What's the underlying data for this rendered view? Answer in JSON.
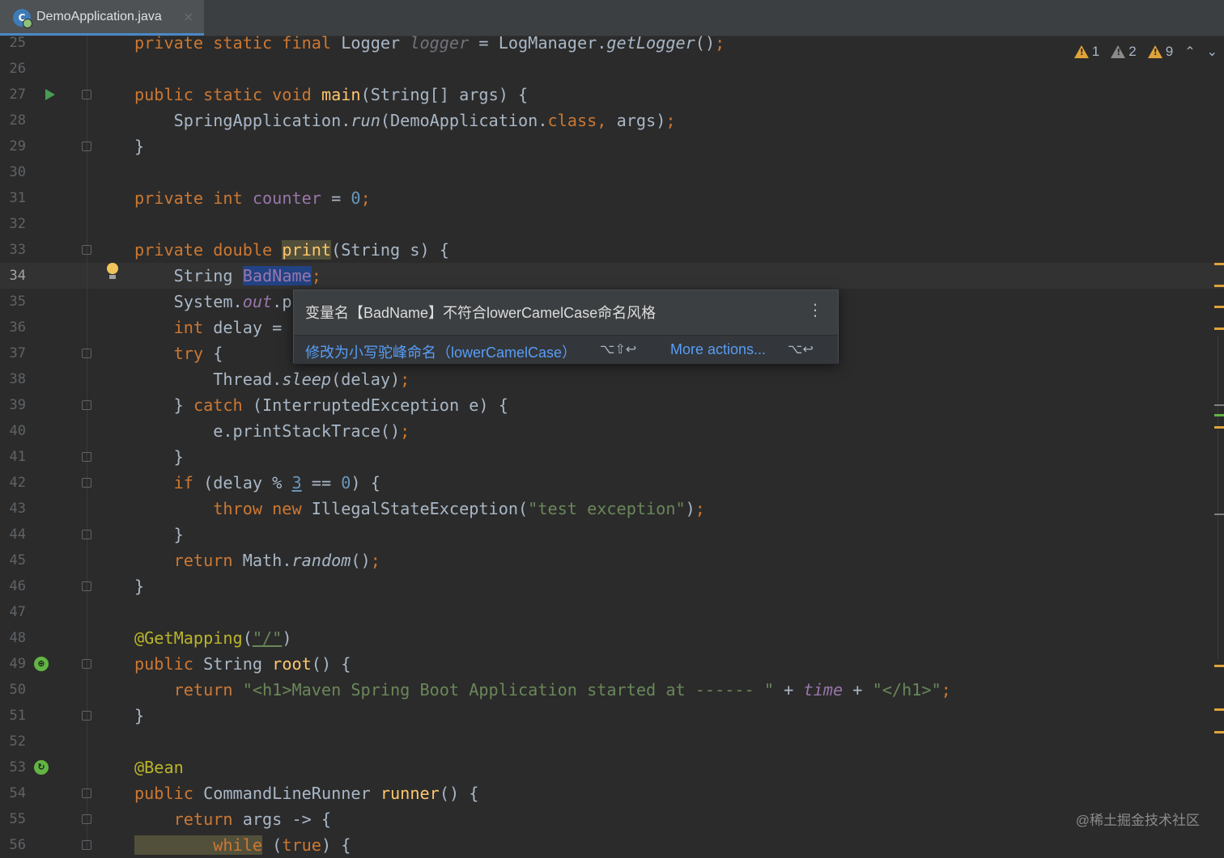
{
  "tab": {
    "file_name": "DemoApplication.java",
    "icon_letter": "C",
    "close_glyph": "×"
  },
  "inspections": {
    "warnings_1": "1",
    "warnings_2": "2",
    "warnings_3": "9",
    "up": "⌃",
    "down": "⌄"
  },
  "lines": {
    "l25": "25",
    "l26": "26",
    "l27": "27",
    "l28": "28",
    "l29": "29",
    "l30": "30",
    "l31": "31",
    "l32": "32",
    "l33": "33",
    "l34": "34",
    "l35": "35",
    "l36": "36",
    "l37": "37",
    "l38": "38",
    "l39": "39",
    "l40": "40",
    "l41": "41",
    "l42": "42",
    "l43": "43",
    "l44": "44",
    "l45": "45",
    "l46": "46",
    "l47": "47",
    "l48": "48",
    "l49": "49",
    "l50": "50",
    "l51": "51",
    "l52": "52",
    "l53": "53",
    "l54": "54",
    "l55": "55",
    "l56": "56"
  },
  "code": {
    "c25": {
      "k": "private static final",
      "t1": " Logger ",
      "var": "logger",
      "t2": " = LogManager.",
      "m": "getLogger",
      "t3": "()",
      "p": ";"
    },
    "c27": {
      "k": "public static void",
      "m": "main",
      "t1": "(String[] args) {"
    },
    "c28": {
      "t1": "    SpringApplication.",
      "m": "run",
      "t2": "(DemoApplication.",
      "k": "class,",
      "t3": " args)",
      "p": ";"
    },
    "c29": "}",
    "c31": {
      "k": "private int",
      "f": "counter",
      "t1": " = ",
      "n": "0",
      "p": ";"
    },
    "c33": {
      "k": "private double",
      "m": "print",
      "t1": "(String s) {"
    },
    "c34": {
      "t1": "    String ",
      "var": "BadName",
      "p": ";"
    },
    "c35": {
      "t1": "    System.",
      "f": "out",
      "t2": ".p"
    },
    "c36": {
      "k": "    int",
      "t1": " delay ="
    },
    "c37": {
      "k": "    try",
      "t1": " {"
    },
    "c38": {
      "t1": "        Thread.",
      "m": "sleep",
      "t2": "(delay)",
      "p": ";"
    },
    "c39": {
      "t1": "    } ",
      "k": "catch",
      "t2": " (InterruptedException e) {"
    },
    "c40": {
      "t1": "        e.printStackTrace()",
      "p": ";"
    },
    "c41": "    }",
    "c42": {
      "k": "    if",
      "t1": " (delay % ",
      "n1": "3",
      "t2": " == ",
      "n2": "0",
      "t3": ") {"
    },
    "c43": {
      "k": "        throw new",
      "t1": " IllegalStateException(",
      "s": "\"test exception\"",
      "t2": ")",
      "p": ";"
    },
    "c44": "    }",
    "c45": {
      "k": "    return",
      "t1": " Math.",
      "m": "random",
      "t2": "()",
      "p": ";"
    },
    "c46": "}",
    "c48": {
      "a": "@GetMapping",
      "t1": "(",
      "s": "\"/\"",
      "t2": ")"
    },
    "c49": {
      "k": "public",
      "t1": " String ",
      "m": "root",
      "t2": "() {"
    },
    "c50": {
      "k": "    return",
      "s1": " \"<h1>Maven Spring Boot Application started at ------ \"",
      "t1": " + ",
      "fi": "time",
      "t2": " + ",
      "s2": "\"</h1>\"",
      "p": ";"
    },
    "c51": "}",
    "c53": {
      "a": "@Bean"
    },
    "c54": {
      "k": "public",
      "t1": " CommandLineRunner ",
      "m": "runner",
      "t2": "() {"
    },
    "c55": {
      "k": "    return",
      "t1": " args -> {"
    },
    "c56": {
      "k1": "        while",
      "t1": " (",
      "k2": "true",
      "t2": ") {"
    }
  },
  "popup": {
    "message": "变量名【BadName】不符合lowerCamelCase命名风格",
    "fix_label": "修改为小写驼峰命名（lowerCamelCase）",
    "fix_shortcut": "⌥⇧↩",
    "more_label": "More actions...",
    "more_shortcut": "⌥↩",
    "kebab": "⋮"
  },
  "watermark": "@稀土掘金技术社区",
  "colors": {
    "bg": "#2b2b2b",
    "keyword": "#cc7832",
    "field": "#9876aa",
    "number": "#6897bb",
    "string": "#6a8759",
    "annotation": "#bbb529",
    "method": "#ffc66d",
    "link": "#589df6",
    "warning": "#e0a33a"
  }
}
